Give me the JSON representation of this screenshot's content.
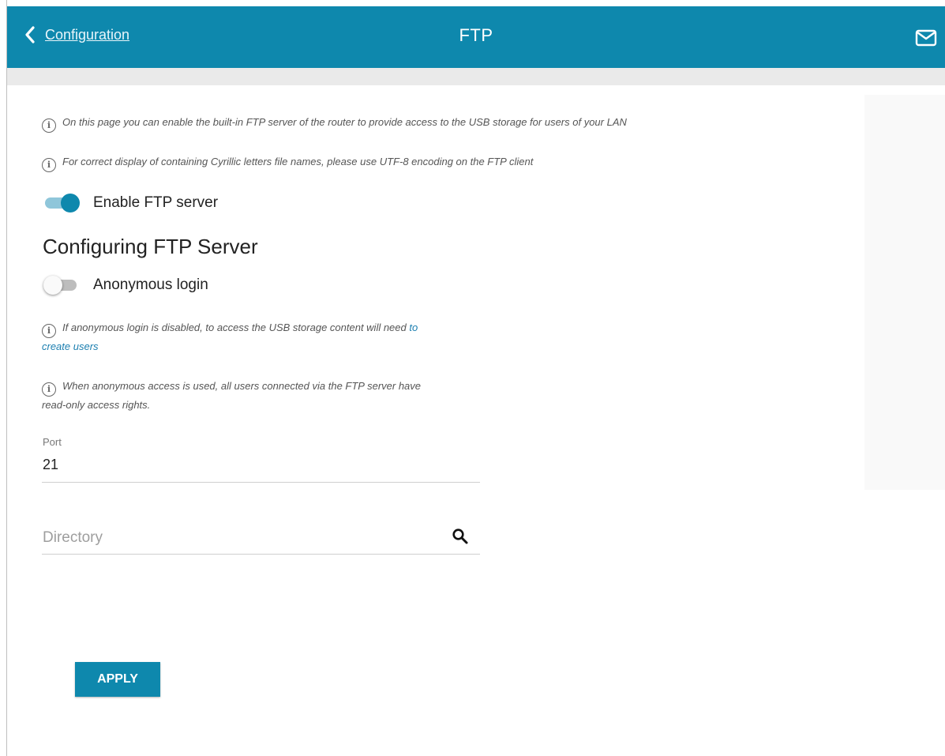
{
  "header": {
    "back_label": "Configuration",
    "title": "FTP",
    "icons": {
      "back": "chevron-left-icon",
      "mail": "mail-icon"
    }
  },
  "info": {
    "intro": "On this page you can enable the built-in FTP server of the router to provide access to the USB storage for users of your LAN",
    "encoding": "For correct display of containing Cyrillic letters file names, please use UTF-8 encoding on the FTP client",
    "anon_disabled_prefix": "If anonymous login is disabled, to access the USB storage content will need ",
    "anon_disabled_link_1": "to",
    "anon_disabled_link_2": "create users",
    "anon_used_line1": "When anonymous access is used, all users connected via the FTP server have",
    "anon_used_line2": "read-only access rights."
  },
  "toggles": {
    "enable_ftp": {
      "label": "Enable FTP server",
      "state": "on"
    },
    "anonymous": {
      "label": "Anonymous login",
      "state": "off"
    }
  },
  "section": {
    "title": "Configuring FTP Server"
  },
  "fields": {
    "port": {
      "label": "Port",
      "value": "21"
    },
    "directory": {
      "placeholder": "Directory"
    }
  },
  "actions": {
    "apply": "APPLY"
  },
  "colors": {
    "accent": "#0e88ad",
    "link": "#1c7fb0"
  }
}
